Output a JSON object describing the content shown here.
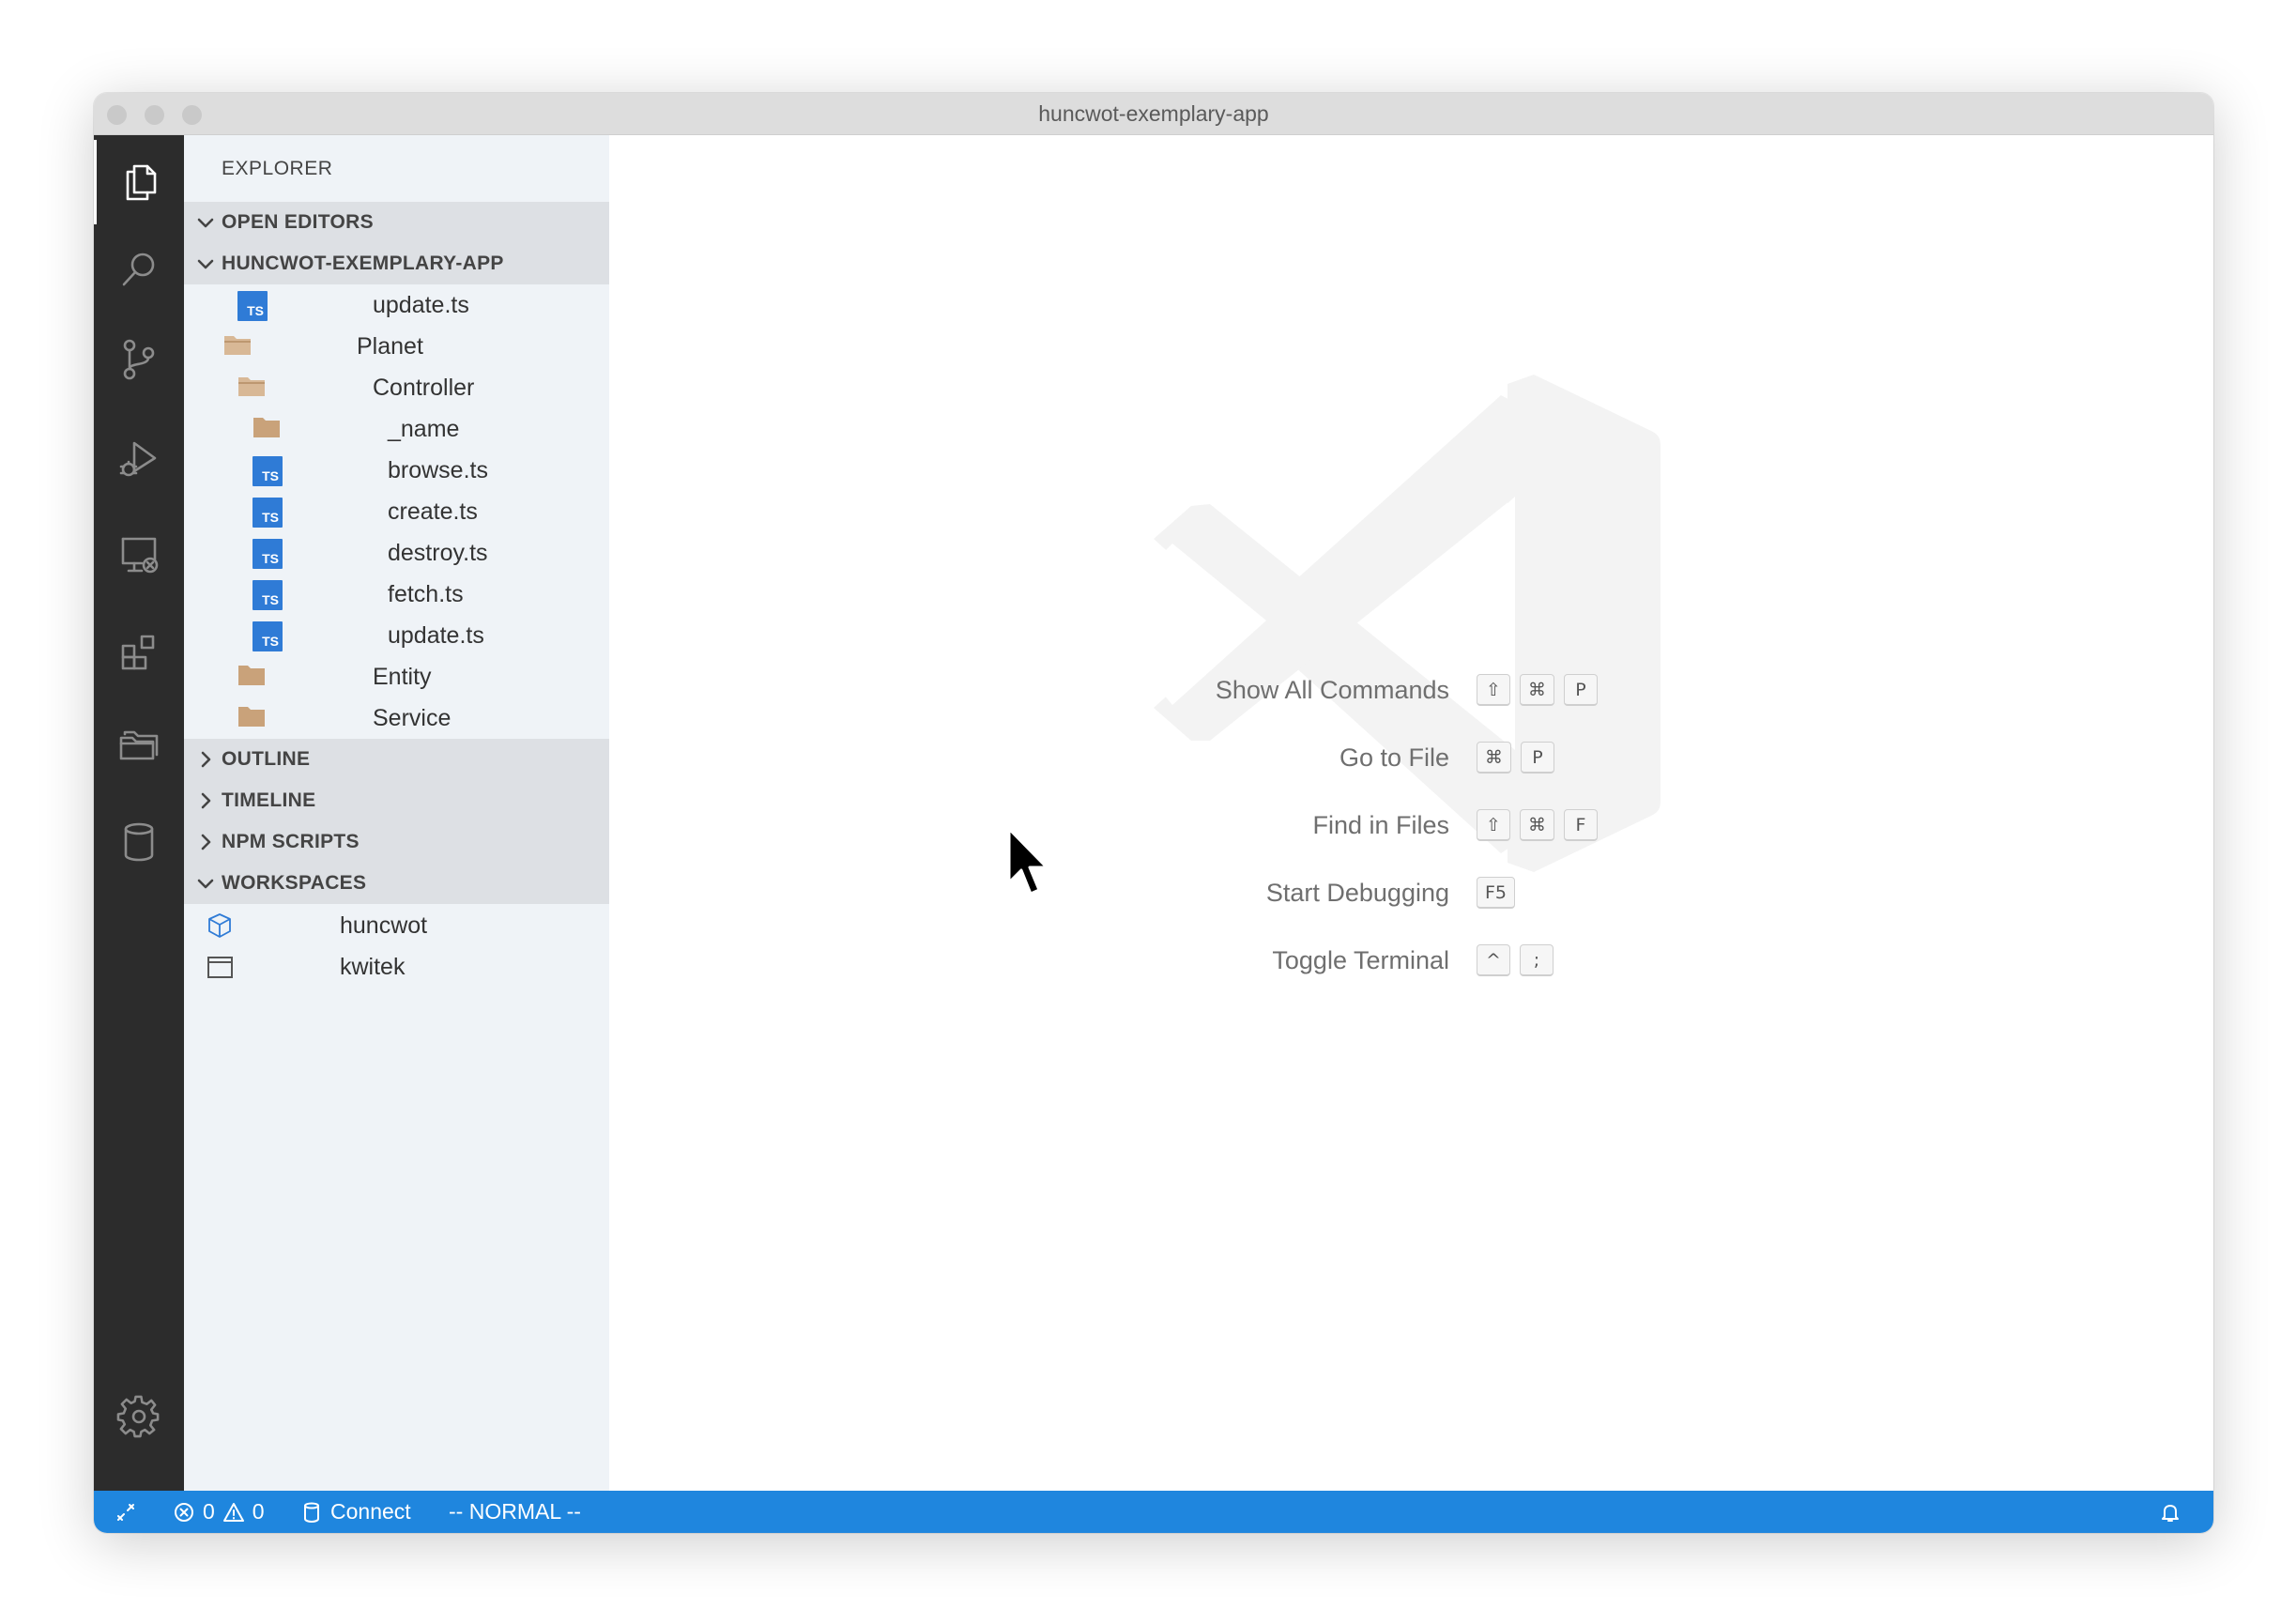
{
  "window": {
    "title": "huncwot-exemplary-app"
  },
  "activity_bar": {
    "items": [
      {
        "icon": "files-icon",
        "active": true
      },
      {
        "icon": "search-icon"
      },
      {
        "icon": "source-control-icon"
      },
      {
        "icon": "run-debug-icon"
      },
      {
        "icon": "remote-explorer-icon"
      },
      {
        "icon": "extensions-icon"
      },
      {
        "icon": "folders-icon"
      },
      {
        "icon": "database-icon"
      }
    ],
    "bottom": {
      "icon": "gear-icon"
    }
  },
  "sidebar": {
    "title": "EXPLORER",
    "sections": {
      "open_editors": "OPEN EDITORS",
      "project": "HUNCWOT-EXEMPLARY-APP",
      "outline": "OUTLINE",
      "timeline": "TIMELINE",
      "npm_scripts": "NPM SCRIPTS",
      "workspaces": "WORKSPACES"
    },
    "tree": [
      {
        "label": "update.ts",
        "type": "ts"
      },
      {
        "label": "Planet",
        "type": "folder-open"
      },
      {
        "label": "Controller",
        "type": "folder-open"
      },
      {
        "label": "_name",
        "type": "folder"
      },
      {
        "label": "browse.ts",
        "type": "ts"
      },
      {
        "label": "create.ts",
        "type": "ts"
      },
      {
        "label": "destroy.ts",
        "type": "ts"
      },
      {
        "label": "fetch.ts",
        "type": "ts"
      },
      {
        "label": "update.ts",
        "type": "ts"
      },
      {
        "label": "Entity",
        "type": "folder"
      },
      {
        "label": "Service",
        "type": "folder"
      }
    ],
    "workspaces": [
      {
        "label": "huncwot",
        "icon": "package-icon"
      },
      {
        "label": "kwitek",
        "icon": "window-icon"
      }
    ]
  },
  "editor": {
    "commands": [
      {
        "label": "Show All Commands",
        "keys": [
          "⇧",
          "⌘",
          "P"
        ]
      },
      {
        "label": "Go to File",
        "keys": [
          "⌘",
          "P"
        ]
      },
      {
        "label": "Find in Files",
        "keys": [
          "⇧",
          "⌘",
          "F"
        ]
      },
      {
        "label": "Start Debugging",
        "keys": [
          "F5"
        ]
      },
      {
        "label": "Toggle Terminal",
        "keys": [
          "^",
          ";"
        ]
      }
    ]
  },
  "status_bar": {
    "errors": "0",
    "warnings": "0",
    "connect": "Connect",
    "mode": "-- NORMAL --"
  },
  "colors": {
    "status_bar": "#1f86de",
    "activity_bar": "#2c2c2c",
    "sidebar": "#eff3f7",
    "ts_icon": "#2f7bd6",
    "folder": "#c9a27a"
  }
}
